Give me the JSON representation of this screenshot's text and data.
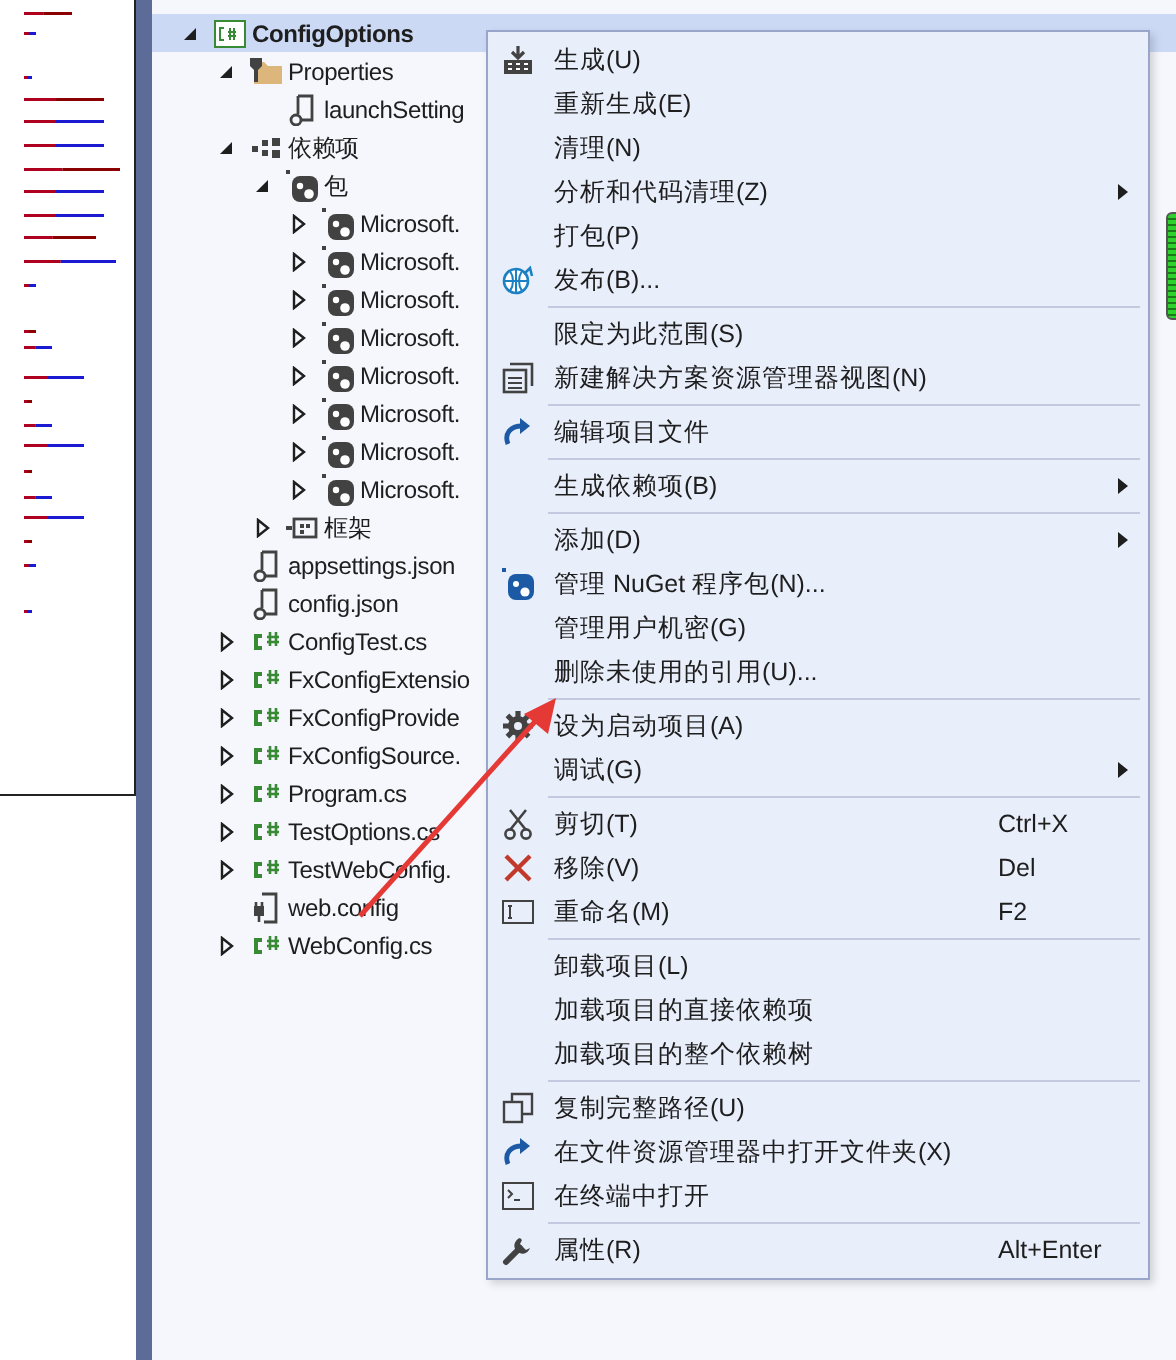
{
  "tree": [
    {
      "label": "ConfigOptions",
      "kind": "project",
      "expanded": true,
      "selected": true,
      "children": [
        {
          "label": "Properties",
          "kind": "properties",
          "expanded": true,
          "selected": false,
          "children": [
            {
              "label": "launchSetting",
              "kind": "script",
              "selected": false
            }
          ]
        },
        {
          "label": "依赖项",
          "kind": "dependencies",
          "expanded": true,
          "selected": false,
          "children": [
            {
              "label": "包",
              "kind": "package",
              "expanded": true,
              "selected": false,
              "children": [
                {
                  "label": "Microsoft.",
                  "kind": "package",
                  "expanded": false,
                  "selected": false
                },
                {
                  "label": "Microsoft.",
                  "kind": "package",
                  "expanded": false,
                  "selected": false
                },
                {
                  "label": "Microsoft.",
                  "kind": "package",
                  "expanded": false,
                  "selected": false
                },
                {
                  "label": "Microsoft.",
                  "kind": "package",
                  "expanded": false,
                  "selected": false
                },
                {
                  "label": "Microsoft.",
                  "kind": "package",
                  "expanded": false,
                  "selected": false
                },
                {
                  "label": "Microsoft.",
                  "kind": "package",
                  "expanded": false,
                  "selected": false
                },
                {
                  "label": "Microsoft.",
                  "kind": "package",
                  "expanded": false,
                  "selected": false
                },
                {
                  "label": "Microsoft.",
                  "kind": "package",
                  "expanded": false,
                  "selected": false
                }
              ]
            },
            {
              "label": "框架",
              "kind": "framework",
              "expanded": false,
              "selected": false
            }
          ]
        },
        {
          "label": "appsettings.json",
          "kind": "script",
          "selected": false
        },
        {
          "label": "config.json",
          "kind": "script",
          "selected": false
        },
        {
          "label": "ConfigTest.cs",
          "kind": "csharp",
          "expanded": false,
          "selected": false
        },
        {
          "label": "FxConfigExtensio",
          "kind": "csharp",
          "expanded": false,
          "selected": false
        },
        {
          "label": "FxConfigProvide",
          "kind": "csharp",
          "expanded": false,
          "selected": false
        },
        {
          "label": "FxConfigSource.",
          "kind": "csharp",
          "expanded": false,
          "selected": false
        },
        {
          "label": "Program.cs",
          "kind": "csharp",
          "expanded": false,
          "selected": false
        },
        {
          "label": "TestOptions.cs",
          "kind": "csharp",
          "expanded": false,
          "selected": false
        },
        {
          "label": "TestWebConfig.",
          "kind": "csharp",
          "expanded": false,
          "selected": false
        },
        {
          "label": "web.config",
          "kind": "config",
          "selected": false
        },
        {
          "label": "WebConfig.cs",
          "kind": "csharp",
          "expanded": false,
          "selected": false
        }
      ]
    }
  ],
  "context_menu": [
    {
      "kind": "build",
      "label": "生成(U)"
    },
    {
      "kind": "plain",
      "label": "重新生成(E)"
    },
    {
      "kind": "plain",
      "label": "清理(N)"
    },
    {
      "kind": "plain",
      "label": "分析和代码清理(Z)",
      "submenu": true
    },
    {
      "kind": "plain",
      "label": "打包(P)"
    },
    {
      "kind": "globe",
      "label": "发布(B)..."
    },
    {
      "kind": "separator"
    },
    {
      "kind": "plain",
      "label": "限定为此范围(S)"
    },
    {
      "kind": "window",
      "label": "新建解决方案资源管理器视图(N)"
    },
    {
      "kind": "separator"
    },
    {
      "kind": "redo",
      "label": "编辑项目文件"
    },
    {
      "kind": "separator"
    },
    {
      "kind": "plain",
      "label": "生成依赖项(B)",
      "submenu": true
    },
    {
      "kind": "separator"
    },
    {
      "kind": "plain",
      "label": "添加(D)",
      "submenu": true
    },
    {
      "kind": "package",
      "label": "管理 NuGet 程序包(N)..."
    },
    {
      "kind": "plain",
      "label": "管理用户机密(G)"
    },
    {
      "kind": "plain",
      "label": "删除未使用的引用(U)..."
    },
    {
      "kind": "separator"
    },
    {
      "kind": "gear",
      "label": "设为启动项目(A)"
    },
    {
      "kind": "plain",
      "label": "调试(G)",
      "submenu": true
    },
    {
      "kind": "separator"
    },
    {
      "kind": "cut",
      "label": "剪切(T)",
      "shortcut": "Ctrl+X"
    },
    {
      "kind": "remove",
      "label": "移除(V)",
      "shortcut": "Del"
    },
    {
      "kind": "rename",
      "label": "重命名(M)",
      "shortcut": "F2"
    },
    {
      "kind": "separator"
    },
    {
      "kind": "plain",
      "label": "卸载项目(L)"
    },
    {
      "kind": "plain",
      "label": "加载项目的直接依赖项"
    },
    {
      "kind": "plain",
      "label": "加载项目的整个依赖树"
    },
    {
      "kind": "separator"
    },
    {
      "kind": "copy",
      "label": "复制完整路径(U)"
    },
    {
      "kind": "redo",
      "label": "在文件资源管理器中打开文件夹(X)"
    },
    {
      "kind": "terminal",
      "label": "在终端中打开"
    },
    {
      "kind": "separator"
    },
    {
      "kind": "wrench",
      "label": "属性(R)",
      "shortcut": "Alt+Enter"
    }
  ]
}
